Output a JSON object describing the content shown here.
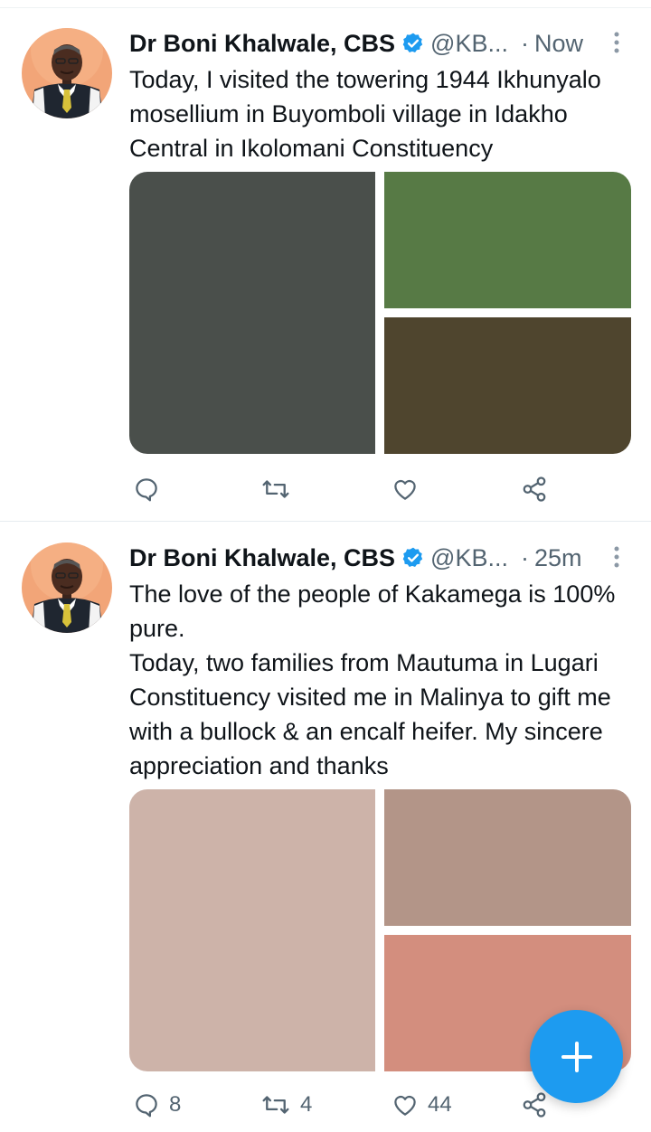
{
  "colors": {
    "accent": "#1d9bf0",
    "secondary_text": "#536471",
    "primary_text": "#0f1419"
  },
  "tweets": [
    {
      "author": {
        "name": "Dr Boni Khalwale, CBS",
        "handle": "@KB...",
        "verified_icon": "verified-badge-icon",
        "avatar": "profile-photo"
      },
      "separator": "·",
      "time": "Now",
      "text": [
        "Today, I visited the towering 1944 Ikhunyalo mosellium in Buyomboli village in Idakho Central in Ikolomani Constituency"
      ],
      "images": [
        {
          "label": "photo-1",
          "color": "#4a4f4b"
        },
        {
          "label": "photo-2",
          "color": "#577a45"
        },
        {
          "label": "photo-3",
          "color": "#4f452e"
        }
      ],
      "actions": {
        "reply": "",
        "retweet": "",
        "like": "",
        "share": ""
      }
    },
    {
      "author": {
        "name": "Dr Boni Khalwale, CBS",
        "handle": "@KB...",
        "verified_icon": "verified-badge-icon",
        "avatar": "profile-photo"
      },
      "separator": "·",
      "time": "25m",
      "text": [
        "The love of the people of Kakamega is 100% pure.",
        "Today, two families from Mautuma in Lugari Constituency visited me in Malinya to gift me with a bullock & an encalf heifer. My sincere appreciation and thanks"
      ],
      "images": [
        {
          "label": "photo-1",
          "color": "#cdb3a9"
        },
        {
          "label": "photo-2",
          "color": "#b39588"
        },
        {
          "label": "photo-3",
          "color": "#d38e7e"
        }
      ],
      "actions": {
        "reply": "8",
        "retweet": "4",
        "like": "44",
        "share": ""
      }
    }
  ],
  "fab": {
    "icon": "plus-icon"
  }
}
